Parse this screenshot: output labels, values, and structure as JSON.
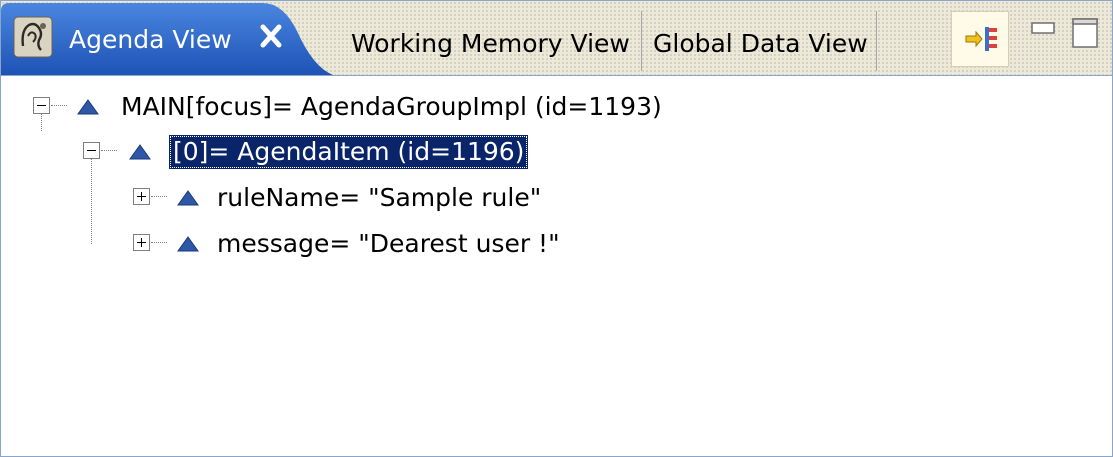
{
  "tabs": {
    "active": {
      "label": "Agenda View",
      "icon": "drools-agenda-icon",
      "close_icon": "close-icon"
    },
    "others": [
      {
        "label": "Working Memory View"
      },
      {
        "label": "Global Data View"
      }
    ]
  },
  "toolbar": {
    "show_logical_structure_icon": "show-logical-structure-icon",
    "minimize_icon": "minimize-icon",
    "maximize_icon": "maximize-icon"
  },
  "tree": {
    "items": [
      {
        "label": "MAIN[focus]= AgendaGroupImpl  (id=1193)",
        "expanded": true,
        "level": 0,
        "selected": false
      },
      {
        "label": "[0]= AgendaItem  (id=1196)",
        "expanded": true,
        "level": 1,
        "selected": true
      },
      {
        "label": "ruleName= \"Sample rule\"",
        "expanded": false,
        "level": 2,
        "selected": false
      },
      {
        "label": "message= \"Dearest user !\"",
        "expanded": false,
        "level": 2,
        "selected": false
      }
    ]
  },
  "colors": {
    "active_tab_bg": "#2a62c6",
    "selection_bg": "#0a246a",
    "border": "#8aa5c9",
    "node_icon": "#2f57a7"
  }
}
